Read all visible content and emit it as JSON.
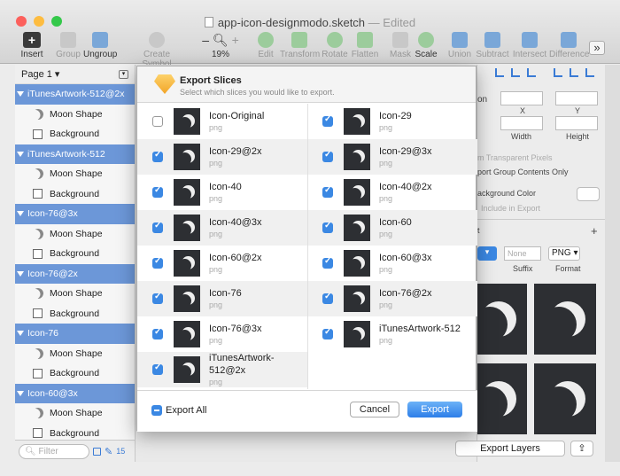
{
  "window": {
    "title": "app-icon-designmodo.sketch",
    "edited": "— Edited",
    "colors": {
      "close": "#fc605c",
      "minimize": "#fdbc40",
      "zoom": "#34c84a",
      "accent": "#3b88e3",
      "artboard": "#6c97d8"
    }
  },
  "toolbar": {
    "items": [
      {
        "label": "Insert",
        "icon": "plus-icon"
      },
      {
        "label": "Group",
        "icon": "group-icon"
      },
      {
        "label": "Ungroup",
        "icon": "ungroup-icon"
      },
      {
        "label": "Create Symbol",
        "icon": "symbol-icon"
      },
      {
        "label": "19%",
        "icon": "zoom-icon"
      },
      {
        "label": "Edit",
        "icon": "edit-icon"
      },
      {
        "label": "Transform",
        "icon": "transform-icon"
      },
      {
        "label": "Rotate",
        "icon": "rotate-icon"
      },
      {
        "label": "Flatten",
        "icon": "flatten-icon"
      },
      {
        "label": "Mask",
        "icon": "mask-icon"
      },
      {
        "label": "Scale",
        "icon": "scale-icon"
      },
      {
        "label": "Union",
        "icon": "union-icon"
      },
      {
        "label": "Subtract",
        "icon": "subtract-icon"
      },
      {
        "label": "Intersect",
        "icon": "intersect-icon"
      },
      {
        "label": "Difference",
        "icon": "difference-icon"
      }
    ],
    "zoom_minus": "–",
    "zoom_plus": "+",
    "more": "»"
  },
  "layers": {
    "page": "Page 1 ▾",
    "filter_placeholder": "Filter",
    "count": "15",
    "rows": [
      {
        "type": "artboard",
        "label": "iTunesArtwork-512@2x"
      },
      {
        "type": "moon",
        "label": "Moon Shape"
      },
      {
        "type": "rect",
        "label": "Background"
      },
      {
        "type": "artboard",
        "label": "iTunesArtwork-512"
      },
      {
        "type": "moon",
        "label": "Moon Shape"
      },
      {
        "type": "rect",
        "label": "Background"
      },
      {
        "type": "artboard",
        "label": "Icon-76@3x"
      },
      {
        "type": "moon",
        "label": "Moon Shape"
      },
      {
        "type": "rect",
        "label": "Background"
      },
      {
        "type": "artboard",
        "label": "Icon-76@2x"
      },
      {
        "type": "moon",
        "label": "Moon Shape"
      },
      {
        "type": "rect",
        "label": "Background"
      },
      {
        "type": "artboard",
        "label": "Icon-76"
      },
      {
        "type": "moon",
        "label": "Moon Shape"
      },
      {
        "type": "rect",
        "label": "Background"
      },
      {
        "type": "artboard",
        "label": "Icon-60@3x"
      },
      {
        "type": "moon",
        "label": "Moon Shape"
      },
      {
        "type": "rect",
        "label": "Background"
      }
    ]
  },
  "inspector": {
    "on": "on",
    "x": "X",
    "y": "Y",
    "width": "Width",
    "height": "Height",
    "trim": "m Transparent Pixels",
    "group": "port Group Contents Only",
    "bg": "ackground Color",
    "include": "Include in Export",
    "t": "t",
    "plus": "+",
    "suffix_ph": "None",
    "suffix": "Suffix",
    "format_val": "PNG",
    "format": "Format",
    "export_layers": "Export Layers",
    "share": "⇪"
  },
  "dialog": {
    "title": "Export Slices",
    "subtitle": "Select which slices you would like to export.",
    "export_all": "Export All",
    "cancel": "Cancel",
    "export": "Export",
    "slices": [
      {
        "name": "Icon-Original",
        "format": "png",
        "checked": false
      },
      {
        "name": "Icon-29",
        "format": "png",
        "checked": true
      },
      {
        "name": "Icon-29@2x",
        "format": "png",
        "checked": true
      },
      {
        "name": "Icon-29@3x",
        "format": "png",
        "checked": true
      },
      {
        "name": "Icon-40",
        "format": "png",
        "checked": true
      },
      {
        "name": "Icon-40@2x",
        "format": "png",
        "checked": true
      },
      {
        "name": "Icon-40@3x",
        "format": "png",
        "checked": true
      },
      {
        "name": "Icon-60",
        "format": "png",
        "checked": true
      },
      {
        "name": "Icon-60@2x",
        "format": "png",
        "checked": true
      },
      {
        "name": "Icon-60@3x",
        "format": "png",
        "checked": true
      },
      {
        "name": "Icon-76",
        "format": "png",
        "checked": true
      },
      {
        "name": "Icon-76@2x",
        "format": "png",
        "checked": true
      },
      {
        "name": "Icon-76@3x",
        "format": "png",
        "checked": true
      },
      {
        "name": "iTunesArtwork-512",
        "format": "png",
        "checked": true
      },
      {
        "name": "iTunesArtwork-512@2x",
        "format": "png",
        "checked": true
      }
    ]
  }
}
